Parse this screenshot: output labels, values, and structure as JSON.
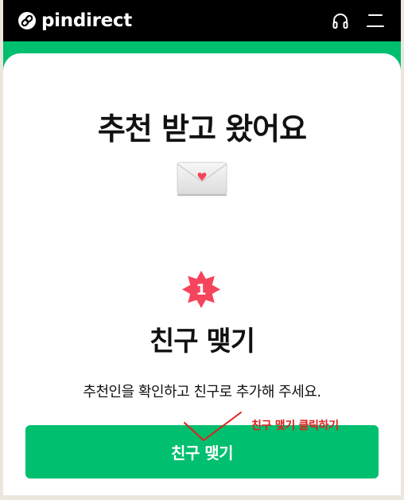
{
  "header": {
    "logo_text": "pindirect",
    "icons": [
      "link-logo-icon",
      "headset-icon",
      "menu-icon"
    ]
  },
  "main": {
    "title": "추천 받고 왔어요",
    "step_number": "1",
    "step_title": "친구 맺기",
    "step_description": "추천인을 확인하고 친구로 추가해 주세요.",
    "button_label": "친구 맺기"
  },
  "annotation": {
    "text": "친구 맺기 클릭하기"
  },
  "colors": {
    "brand_green": "#00bf6f",
    "header_black": "#000000",
    "badge_red": "#f5455c",
    "annotation_red": "#e02020"
  }
}
